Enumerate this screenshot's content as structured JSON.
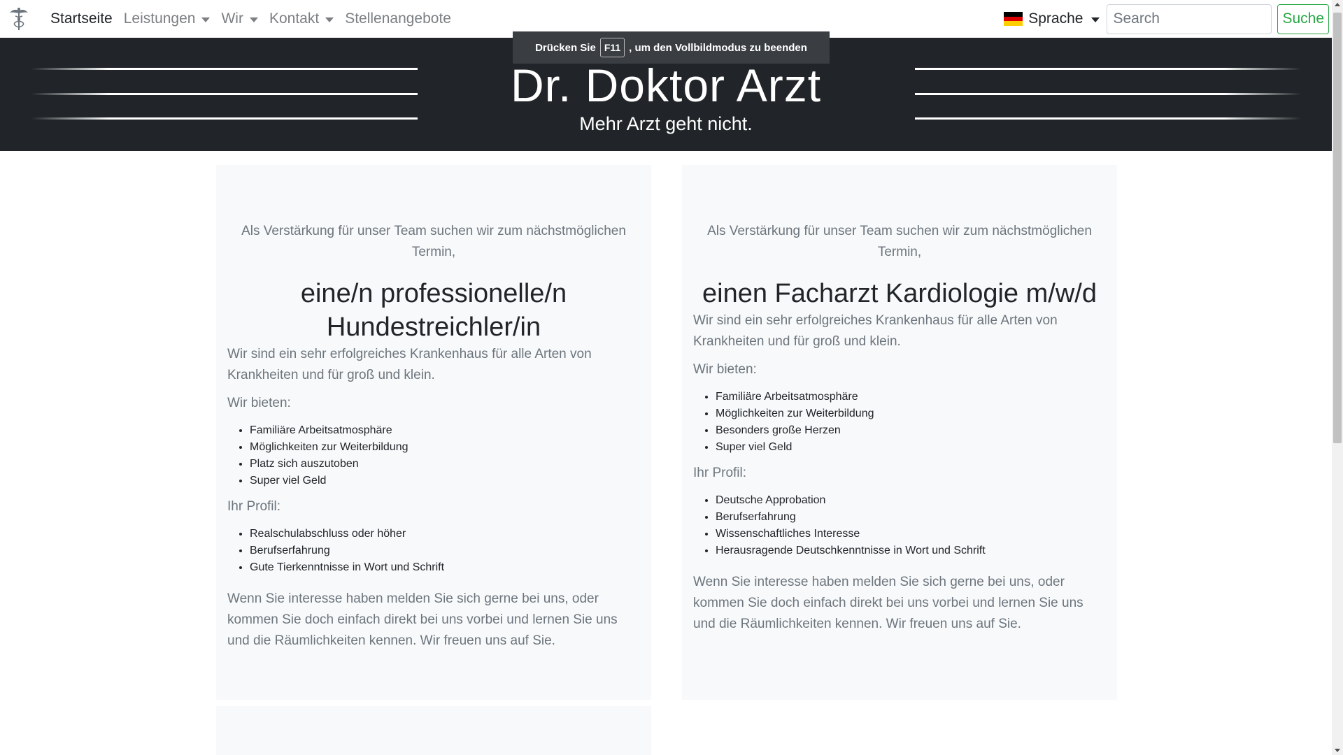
{
  "nav": {
    "brand_icon": "caduceus-icon",
    "items": [
      {
        "label": "Startseite",
        "dropdown": false,
        "active": true
      },
      {
        "label": "Leistungen",
        "dropdown": true,
        "active": false
      },
      {
        "label": "Wir",
        "dropdown": true,
        "active": false
      },
      {
        "label": "Kontakt",
        "dropdown": true,
        "active": false
      },
      {
        "label": "Stellenangebote",
        "dropdown": false,
        "active": false
      }
    ],
    "language_label": "Sprache",
    "language_flag": "german-flag-icon",
    "search_placeholder": "Search",
    "search_button": "Suche"
  },
  "fullscreen_notice": {
    "prefix": "Drücken Sie",
    "key": "F11",
    "suffix": ", um den Vollbildmodus zu beenden"
  },
  "header": {
    "title": "Dr. Doktor Arzt",
    "subtitle": "Mehr Arzt geht nicht."
  },
  "jobs": [
    {
      "intro": "Als Verstärkung für unser Team suchen wir zum nächstmöglichen Termin,",
      "title": "eine/n professionelle/n Hundestreichler/in",
      "description": "Wir sind ein sehr erfolgreiches Krankenhaus für alle Arten von Krankheiten und für groß und klein.",
      "offer_heading": "Wir bieten:",
      "offers": [
        "Familiäre Arbeitsatmosphäre",
        "Möglichkeiten zur Weiterbildung",
        "Platz sich auszutoben",
        "Super viel Geld"
      ],
      "profile_heading": "Ihr Profil:",
      "profile": [
        "Realschulabschluss oder höher",
        "Berufserfahrung",
        "Gute Tierkenntnisse in Wort und Schrift"
      ],
      "closing": "Wenn Sie interesse haben melden Sie sich gerne bei uns, oder kommen Sie doch einfach direkt bei uns vorbei und lernen Sie uns und die Räumlichkeiten kennen. Wir freuen uns auf Sie."
    },
    {
      "intro": "Als Verstärkung für unser Team suchen wir zum nächstmöglichen Termin,",
      "title": "einen Facharzt Kardiologie m/w/d",
      "description": "Wir sind ein sehr erfolgreiches Krankenhaus für alle Arten von Krankheiten und für groß und klein.",
      "offer_heading": "Wir bieten:",
      "offers": [
        "Familiäre Arbeitsatmosphäre",
        "Möglichkeiten zur Weiterbildung",
        "Besonders große Herzen",
        "Super viel Geld"
      ],
      "profile_heading": "Ihr Profil:",
      "profile": [
        "Deutsche Approbation",
        "Berufserfahrung",
        "Wissenschaftliches Interesse",
        "Herausragende Deutschkenntnisse in Wort und Schrift"
      ],
      "closing": "Wenn Sie interesse haben melden Sie sich gerne bei uns, oder kommen Sie doch einfach direkt bei uns vorbei und lernen Sie uns und die Räumlichkeiten kennen. Wir freuen uns auf Sie."
    }
  ],
  "colors": {
    "header_bg": "#212529",
    "card_bg": "#f8f9fa",
    "search_button": "#28a745"
  }
}
